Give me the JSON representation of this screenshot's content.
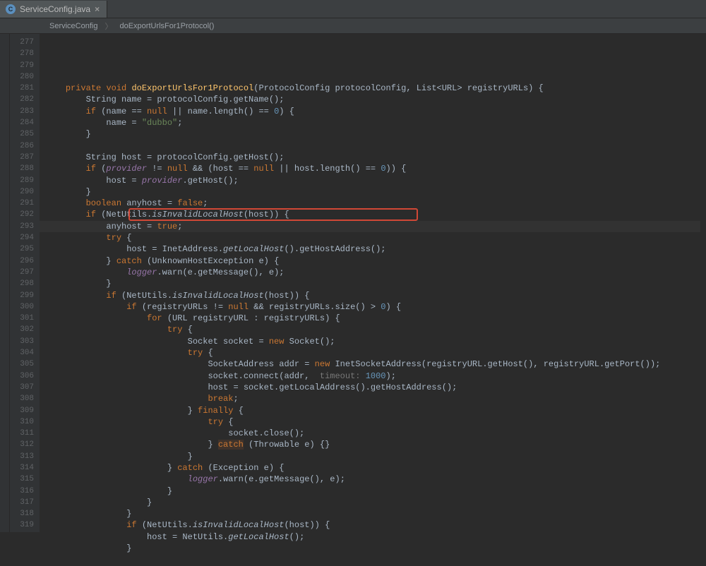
{
  "tab": {
    "filename": "ServiceConfig.java",
    "icon_label": "C"
  },
  "breadcrumbs": {
    "class": "ServiceConfig",
    "method": "doExportUrlsFor1Protocol()"
  },
  "gutter": {
    "start": 277,
    "end": 319
  },
  "code_lines": [
    "",
    "    private void doExportUrlsFor1Protocol(ProtocolConfig protocolConfig, List<URL> registryURLs) {",
    "        String name = protocolConfig.getName();",
    "        if (name == null || name.length() == 0) {",
    "            name = \"dubbo\";",
    "        }",
    "",
    "        String host = protocolConfig.getHost();",
    "        if (provider != null && (host == null || host.length() == 0)) {",
    "            host = provider.getHost();",
    "        }",
    "        boolean anyhost = false;",
    "        if (NetUtils.isInvalidLocalHost(host)) {",
    "            anyhost = true;",
    "            try {",
    "                host = InetAddress.getLocalHost().getHostAddress();",
    "            } catch (UnknownHostException e) {",
    "                logger.warn(e.getMessage(), e);",
    "            }",
    "            if (NetUtils.isInvalidLocalHost(host)) {",
    "                if (registryURLs != null && registryURLs.size() > 0) {",
    "                    for (URL registryURL : registryURLs) {",
    "                        try {",
    "                            Socket socket = new Socket();",
    "                            try {",
    "                                SocketAddress addr = new InetSocketAddress(registryURL.getHost(), registryURL.getPort());",
    "                                socket.connect(addr,  timeout: 1000);",
    "                                host = socket.getLocalAddress().getHostAddress();",
    "                                break;",
    "                            } finally {",
    "                                try {",
    "                                    socket.close();",
    "                                } catch (Throwable e) {}",
    "                            }",
    "                        } catch (Exception e) {",
    "                            logger.warn(e.getMessage(), e);",
    "                        }",
    "                    }",
    "                }",
    "                if (NetUtils.isInvalidLocalHost(host)) {",
    "                    host = NetUtils.getLocalHost();",
    "                }",
    ""
  ],
  "highlight_box": {
    "top_line": 292,
    "left_ch": 17,
    "width_ch": 56
  }
}
